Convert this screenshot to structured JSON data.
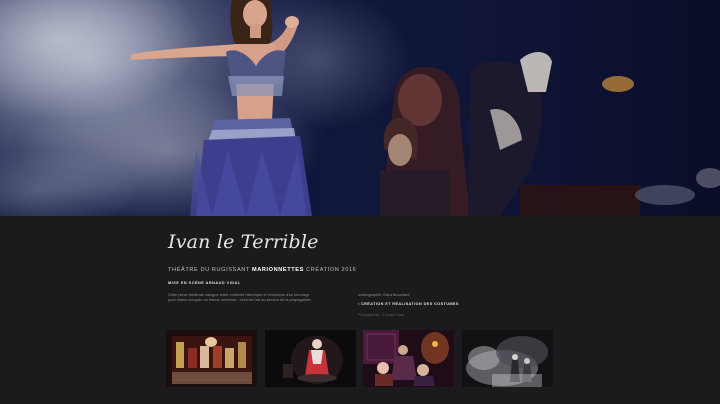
{
  "show": {
    "title": "Ivan le Terrible",
    "subtitle_pre": "THÉÂTRE DU RUGISSANT ",
    "subtitle_highlight": "MARIONNETTES",
    "subtitle_post": " CRÉATION 2016",
    "director": "MISE EN SCÈNE ARNAUD VIDAL",
    "description": "Cette pièce théâtrale navigue entre contexte historique et chronique d'un tournage pour mieux évoquer un thème universel : celui de l'art au service de la propagande.",
    "credit_line": "scénographie Clara Bouchard",
    "credit_creation": "CRÉATION ET RÉALISATION DES COSTUMES",
    "photo_credit": "Photographies : © Arnaud Vidal"
  },
  "gallery": [
    {
      "name": "gallery-thumb-stage-ensemble"
    },
    {
      "name": "gallery-thumb-spotlit-figure"
    },
    {
      "name": "gallery-thumb-red-stage"
    },
    {
      "name": "gallery-thumb-smoke-scene"
    }
  ],
  "colors": {
    "background": "#1b1b1d",
    "hero_blue": "#1a2150",
    "title": "#e9e6df",
    "text_muted": "#8f8f8f"
  }
}
